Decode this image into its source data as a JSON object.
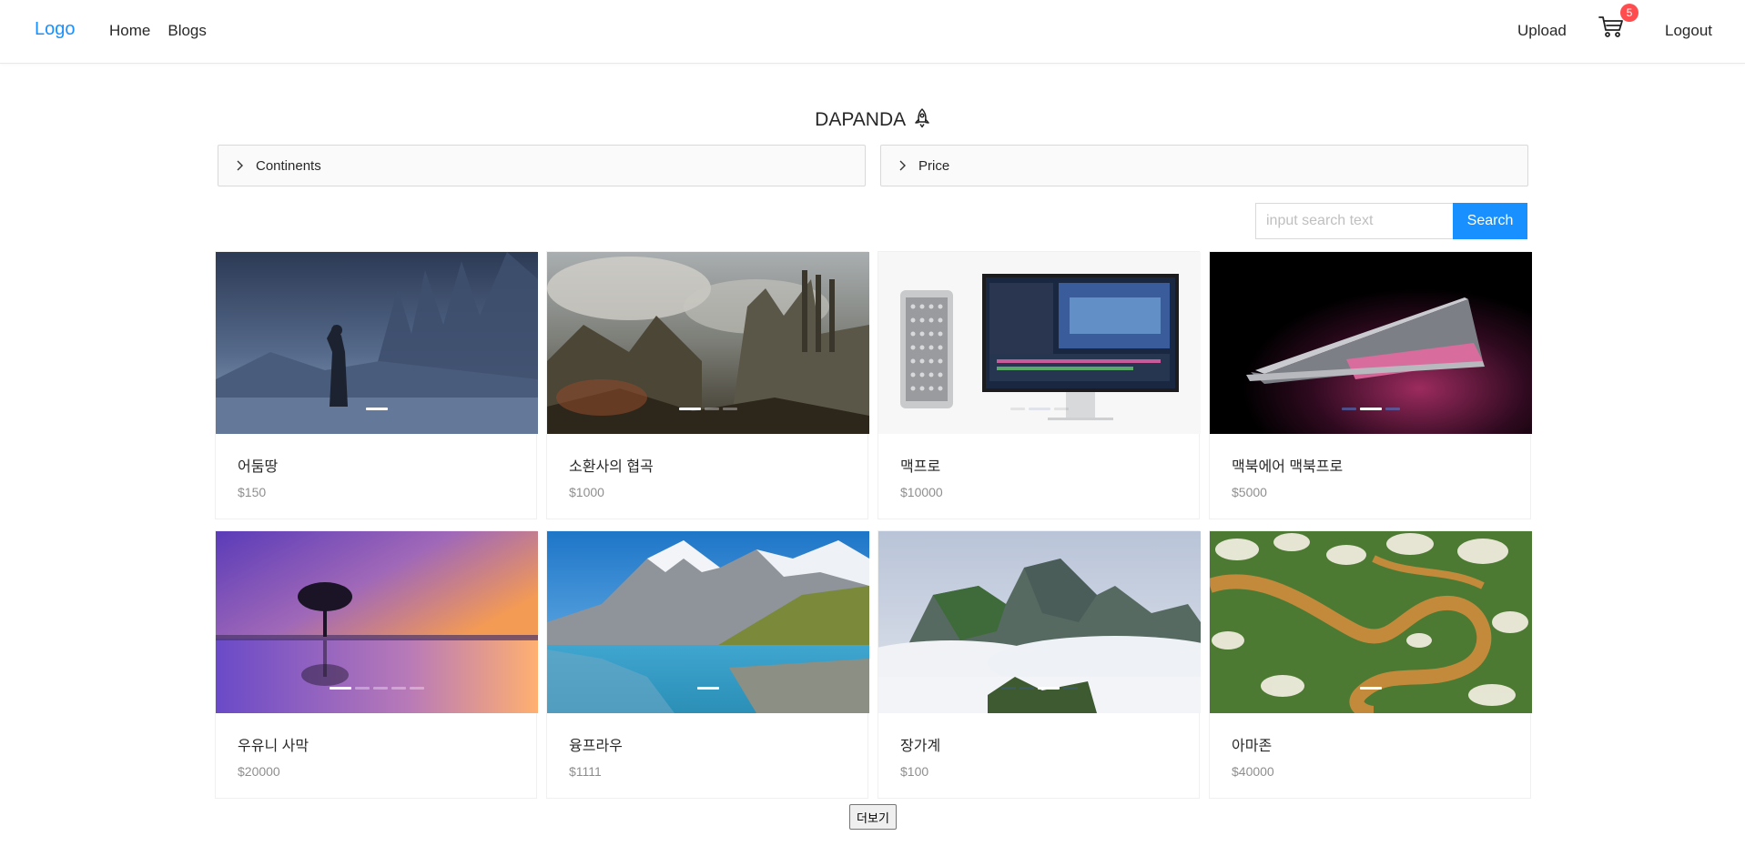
{
  "navbar": {
    "logo": "Logo",
    "links": [
      "Home",
      "Blogs"
    ],
    "upload": "Upload",
    "cart_count": "5",
    "logout": "Logout"
  },
  "title": "DAPANDA",
  "filters": {
    "continents": "Continents",
    "price": "Price"
  },
  "search": {
    "placeholder": "input search text",
    "button": "Search"
  },
  "products": [
    {
      "name": "어둠땅",
      "price": "$150"
    },
    {
      "name": "소환사의 협곡",
      "price": "$1000"
    },
    {
      "name": "맥프로",
      "price": "$10000"
    },
    {
      "name": "맥북에어 맥북프로",
      "price": "$5000"
    },
    {
      "name": "우유니 사막",
      "price": "$20000"
    },
    {
      "name": "융프라우",
      "price": "$1111"
    },
    {
      "name": "장가계",
      "price": "$100"
    },
    {
      "name": "아마존",
      "price": "$40000"
    }
  ],
  "more_button": "더보기",
  "colors": {
    "accent": "#1890ff",
    "badge": "#ff4d4f"
  }
}
